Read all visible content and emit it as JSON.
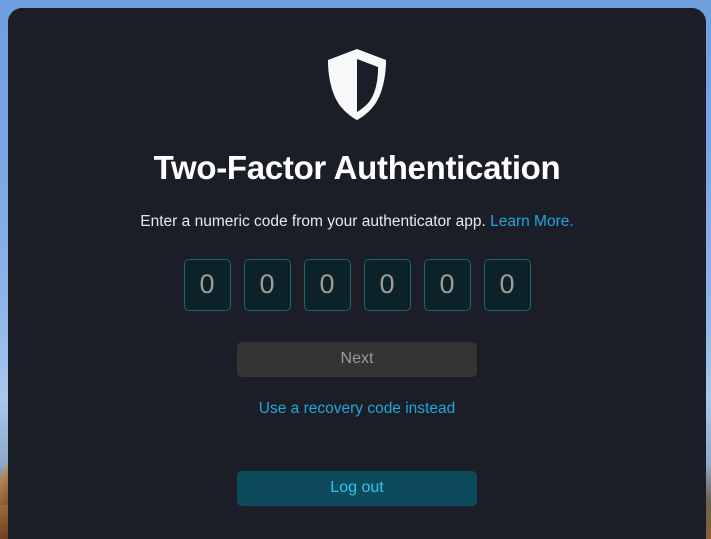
{
  "page": {
    "title": "Two-Factor Authentication",
    "icon": "shield-icon"
  },
  "subtitle": {
    "text": "Enter a numeric code from your authenticator app.",
    "link_label": "Learn More."
  },
  "code_entry": {
    "digit_count": 6,
    "digits": [
      {
        "value": "",
        "placeholder": "0"
      },
      {
        "value": "",
        "placeholder": "0"
      },
      {
        "value": "",
        "placeholder": "0"
      },
      {
        "value": "",
        "placeholder": "0"
      },
      {
        "value": "",
        "placeholder": "0"
      },
      {
        "value": "",
        "placeholder": "0"
      }
    ]
  },
  "actions": {
    "next_label": "Next",
    "recovery_label": "Use a recovery code instead",
    "logout_label": "Log out"
  },
  "colors": {
    "card_background": "#1b1e26",
    "page_background": "#6f9fd8",
    "link": "#21a6dd",
    "input_border": "#1c646f",
    "input_background": "#0a2228",
    "input_placeholder": "#a39c93",
    "next_background": "#343434",
    "next_text": "#9a9a9a",
    "logout_background": "#0d4a5c",
    "logout_text": "#2cc7f0",
    "title_text": "#ffffff",
    "subtitle_text": "#e6e9ee"
  }
}
